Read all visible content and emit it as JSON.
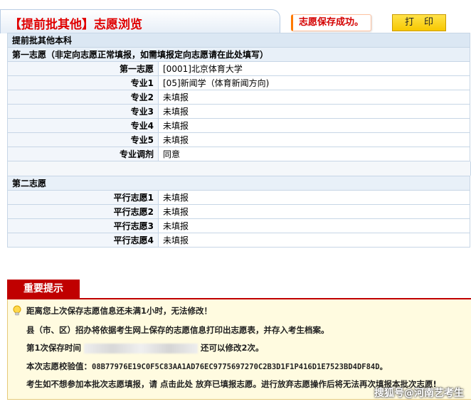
{
  "header": {
    "title": "【提前批其他】志愿浏览",
    "save_message": "志愿保存成功。",
    "print_label": "打印"
  },
  "batch": {
    "name": "提前批其他本科",
    "first": {
      "heading": "第一志愿（非定向志愿正常填报，如需填报定向志愿请在此处填写）",
      "rows": [
        {
          "label": "第一志愿",
          "value": "[0001]北京体育大学"
        },
        {
          "label": "专业1",
          "value": "[05]新闻学（体育新闻方向)"
        },
        {
          "label": "专业2",
          "value": "未填报"
        },
        {
          "label": "专业3",
          "value": "未填报"
        },
        {
          "label": "专业4",
          "value": "未填报"
        },
        {
          "label": "专业5",
          "value": "未填报"
        },
        {
          "label": "专业调剂",
          "value": "同意"
        }
      ]
    },
    "second": {
      "heading": "第二志愿",
      "rows": [
        {
          "label": "平行志愿1",
          "value": "未填报"
        },
        {
          "label": "平行志愿2",
          "value": "未填报"
        },
        {
          "label": "平行志愿3",
          "value": "未填报"
        },
        {
          "label": "平行志愿4",
          "value": "未填报"
        }
      ]
    }
  },
  "notice": {
    "title": "重要提示",
    "line1": "距离您上次保存志愿信息还未满1小时，无法修改！",
    "line2": "县（市、区）招办将依据考生网上保存的志愿信息打印出志愿表，并存入考生档案。",
    "line3_prefix": "第1次保存时间",
    "line3_suffix": "还可以修改2次。",
    "line4_label": "本次志愿校验值：",
    "line4_value": "08B77976E19C0F5C83AA1AD76EC9775697270C2B3D1F1P416D1E7523BD4DF84D。",
    "line5": "考生如不想参加本批次志愿填报，请 点击此处 放弃已填报志愿。进行放弃志愿操作后将无法再次填报本批次志愿!"
  },
  "watermark": "搜狐号@河南艺考生"
}
